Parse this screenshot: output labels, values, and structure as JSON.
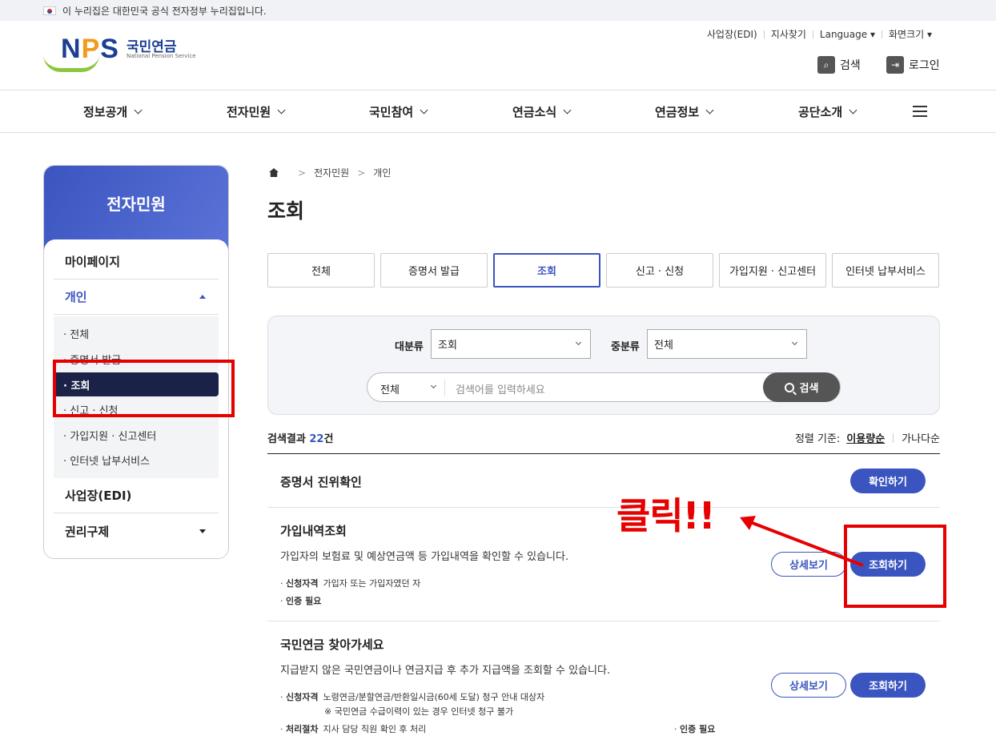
{
  "gov_banner": "이 누리집은 대한민국 공식 전자정부 누리집입니다.",
  "logo": {
    "mark": "NPS",
    "ko": "국민연금",
    "en": "National Pension Service"
  },
  "util": [
    "사업장(EDI)",
    "지사찾기",
    "Language",
    "화면크기"
  ],
  "header_buttons": {
    "search": "검색",
    "login": "로그인"
  },
  "gnb": [
    "정보공개",
    "전자민원",
    "국민참여",
    "연금소식",
    "연금정보",
    "공단소개"
  ],
  "snb": {
    "title": "전자민원",
    "d1": [
      "마이페이지",
      "개인",
      "사업장(EDI)",
      "권리구제"
    ],
    "sub": [
      "· 전체",
      "· 증명서 발급",
      "· 조회",
      "· 신고 · 신청",
      "· 가입지원 · 신고센터",
      "· 인터넷 납부서비스"
    ]
  },
  "breadcrumb": [
    "전자민원",
    "개인"
  ],
  "page_title": "조회",
  "tabs": [
    "전체",
    "증명서 발급",
    "조회",
    "신고 · 신청",
    "가입지원 · 신고센터",
    "인터넷 납부서비스"
  ],
  "search": {
    "major_label": "대분류",
    "major_value": "조회",
    "minor_label": "중분류",
    "minor_value": "전체",
    "type_value": "전체",
    "placeholder": "검색어를 입력하세요",
    "button": "검색"
  },
  "results": {
    "prefix": "검색결과",
    "count": "22",
    "suffix": "건"
  },
  "sort": {
    "label": "정렬 기준:",
    "active": "이용량순",
    "other": "가나다순"
  },
  "items": [
    {
      "title": "증명서 진위확인",
      "btn": "확인하기"
    },
    {
      "title": "가입내역조회",
      "desc": "가입자의 보험료 및 예상연금액 등 가입내역을 확인할 수 있습니다.",
      "m1_label": "신청자격",
      "m1_value": "가입자 또는 가입자였던 자",
      "m2": "인증 필요",
      "detail": "상세보기",
      "btn": "조회하기"
    },
    {
      "title": "국민연금 찾아가세요",
      "desc": "지급받지 않은 국민연금이나 연금지급 후 추가 지급액을 조회할 수 있습니다.",
      "m1_label": "신청자격",
      "m1_value": "노령연금/분할연금/반환일시금(60세 도달) 청구 안내 대상자",
      "m1_note": "※ 국민연금 수급이력이 있는 경우 인터넷 청구 불가",
      "m2_label": "처리절차",
      "m2_value": "지사 담당 직원 확인 후 처리",
      "m3": "인증 필요",
      "detail": "상세보기",
      "btn": "조회하기"
    }
  ],
  "annotation": "클릭!!",
  "colors": {
    "primary": "#3b55c0",
    "annotation": "#e60000"
  }
}
